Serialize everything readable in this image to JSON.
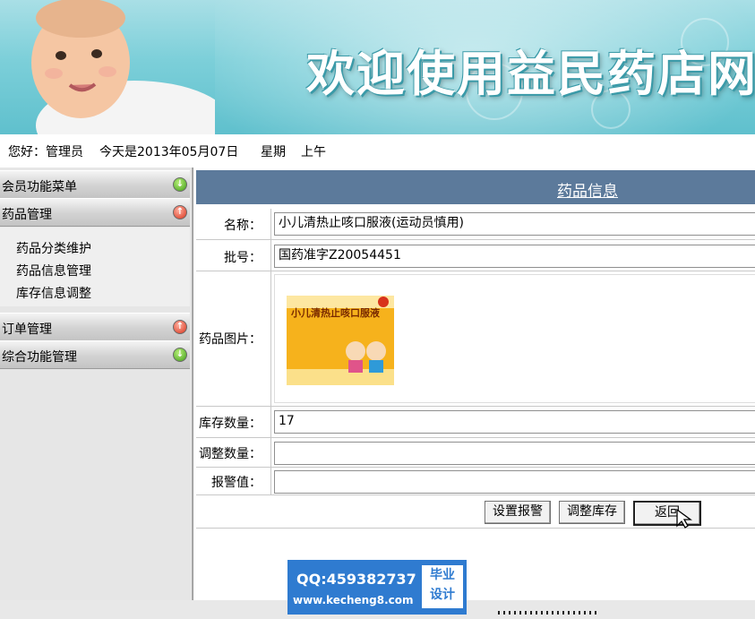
{
  "banner": {
    "title": "欢迎使用益民药店网上"
  },
  "greeting": {
    "hello": "您好：管理员",
    "today": "今天是2013年05月07日",
    "weekday": "星期",
    "period": "上午"
  },
  "sidebar": {
    "menus": [
      {
        "label": "会员功能菜单",
        "icon": "expand-icon"
      },
      {
        "label": "药品管理",
        "icon": "collapse-icon"
      },
      {
        "label": "订单管理",
        "icon": "collapse-icon"
      },
      {
        "label": "综合功能管理",
        "icon": "expand-icon"
      }
    ],
    "drug_items": [
      "药品分类维护",
      "药品信息管理",
      "库存信息调整"
    ]
  },
  "panel": {
    "title": "药品信息",
    "fields": {
      "name_label": "名称：",
      "name_value": "小儿清热止咳口服液(运动员慎用)",
      "batch_label": "批号：",
      "batch_value": "国药准字Z20054451",
      "image_label": "药品图片：",
      "stock_label": "库存数量：",
      "stock_value": "17",
      "adjust_label": "调整数量：",
      "adjust_value": "",
      "alarm_label": "报警值：",
      "alarm_value": ""
    },
    "product_image_text": "小儿清热止咳口服液",
    "buttons": {
      "set_alarm": "设置报警",
      "adjust_stock": "调整库存",
      "back": "返回"
    }
  },
  "watermark": {
    "qq": "QQ:459382737",
    "site": "www.kecheng8.com",
    "tag1": "毕业",
    "tag2": "设计"
  }
}
